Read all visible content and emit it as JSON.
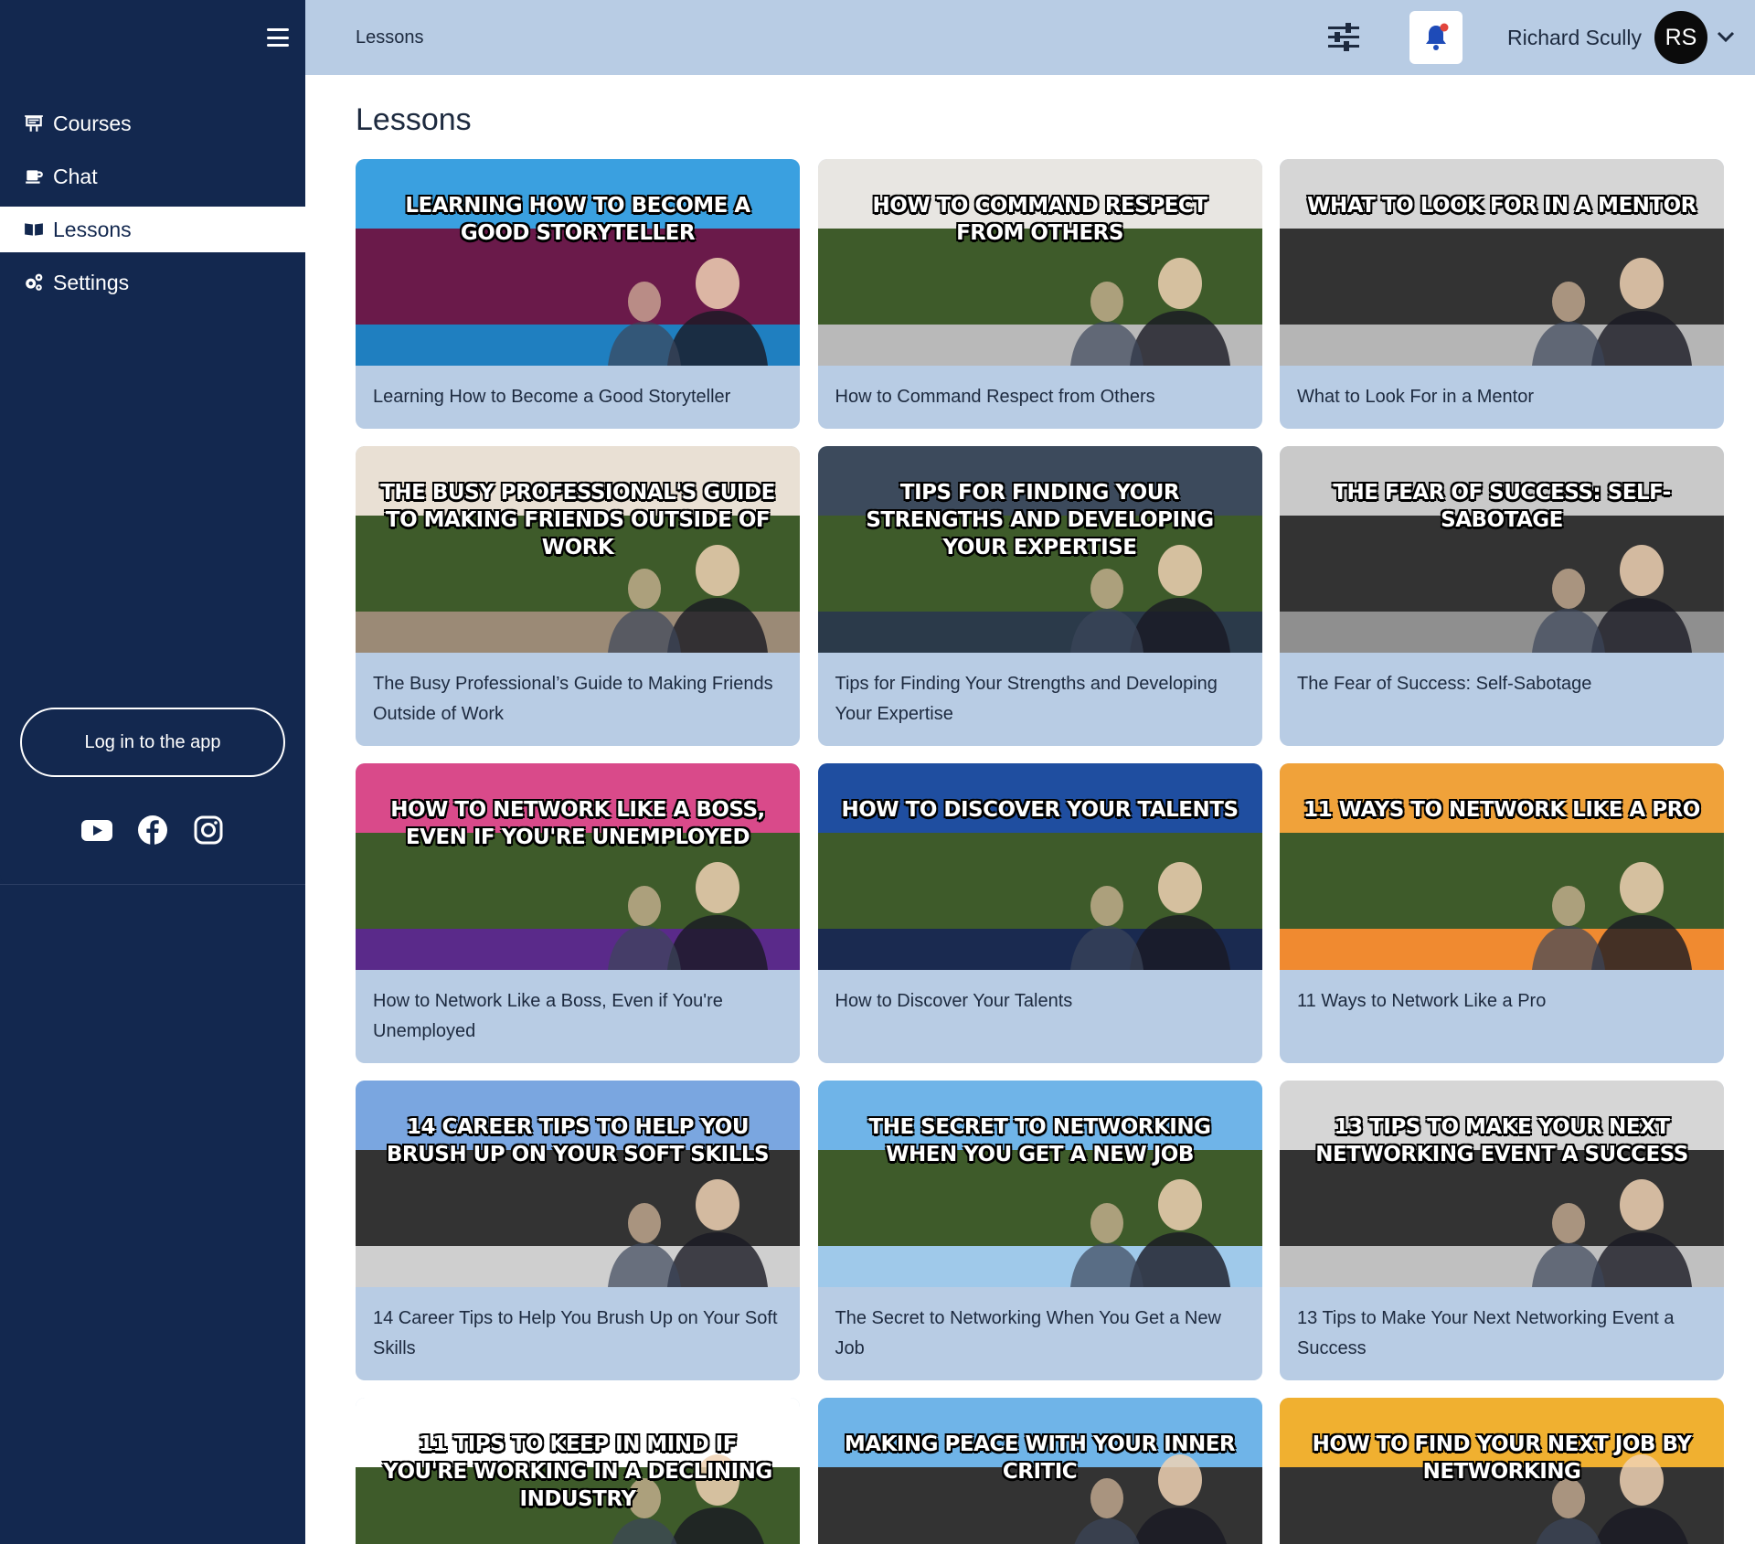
{
  "sidebar": {
    "nav": [
      {
        "label": "Courses",
        "icon": "presentation-icon"
      },
      {
        "label": "Chat",
        "icon": "coffee-icon"
      },
      {
        "label": "Lessons",
        "icon": "book-icon",
        "active": true
      },
      {
        "label": "Settings",
        "icon": "gears-icon"
      }
    ],
    "login_label": "Log in to the app",
    "social": [
      "youtube-icon",
      "facebook-icon",
      "instagram-icon"
    ]
  },
  "header": {
    "breadcrumb": "Lessons",
    "user_name": "Richard Scully",
    "avatar_initials": "RS"
  },
  "main": {
    "title": "Lessons",
    "lessons": [
      {
        "thumb_title": "Learning how to become a good storyteller",
        "label": "Learning How to Become a Good Storyteller",
        "colors": [
          "#3aa0e0",
          "#6a1a4a",
          "#1f7fc0"
        ]
      },
      {
        "thumb_title": "How to command respect from others",
        "label": "How to Command Respect from Others",
        "colors": [
          "#e8e6e2",
          "#3e5b2a",
          "#b9b9b9"
        ]
      },
      {
        "thumb_title": "What to look for in a mentor",
        "label": "What to Look For in a Mentor",
        "colors": [
          "#d6d6d6",
          "#333333",
          "#b5b5b5"
        ]
      },
      {
        "thumb_title": "The busy professional's guide to making friends outside of work",
        "label": "The Busy Professional’s Guide to Making Friends Outside of Work",
        "colors": [
          "#e9e0d4",
          "#3e5b2a",
          "#9b8a76"
        ]
      },
      {
        "thumb_title": "Tips for finding your strengths and developing your expertise",
        "label": "Tips for Finding Your Strengths and Developing Your Expertise",
        "colors": [
          "#3c4a5c",
          "#3e5b2a",
          "#2b3a4a"
        ]
      },
      {
        "thumb_title": "The fear of success: self-sabotage",
        "label": "The Fear of Success: Self-Sabotage",
        "colors": [
          "#c9c9c9",
          "#333333",
          "#8f8f8f"
        ]
      },
      {
        "thumb_title": "How to network like a boss, even if you're unemployed",
        "label": "How to Network Like a Boss, Even if You're Unemployed",
        "colors": [
          "#d94a8a",
          "#3e5b2a",
          "#5a2a8a"
        ]
      },
      {
        "thumb_title": "How to discover your talents",
        "label": "How to Discover Your Talents",
        "colors": [
          "#1f4ea0",
          "#3e5b2a",
          "#1a2a50"
        ]
      },
      {
        "thumb_title": "11 ways to network like a pro",
        "label": "11 Ways to Network Like a Pro",
        "colors": [
          "#f0a23a",
          "#3e5b2a",
          "#f08a30"
        ]
      },
      {
        "thumb_title": "14 Career Tips to Help You Brush Up on Your Soft Skills",
        "label": "14 Career Tips to Help You Brush Up on Your Soft Skills",
        "colors": [
          "#7aa6e0",
          "#333333",
          "#cfcfcf"
        ]
      },
      {
        "thumb_title": "The secret to networking when you get a new job",
        "label": "The Secret to Networking When You Get a New Job",
        "colors": [
          "#6fb4e8",
          "#3e5b2a",
          "#9fc9ea"
        ]
      },
      {
        "thumb_title": "13 tips to make your next networking event a success",
        "label": "13 Tips to Make Your Next Networking Event a Success",
        "colors": [
          "#d6d6d6",
          "#333333",
          "#c0c0c0"
        ]
      },
      {
        "thumb_title": "11 tips to keep in mind if you're working in a declining industry",
        "label": "",
        "colors": [
          "#ffffff",
          "#3e5b2a",
          "#3e5b2a"
        ]
      },
      {
        "thumb_title": "Making peace with your inner critic",
        "label": "",
        "colors": [
          "#6fb4e8",
          "#333333",
          "#333333"
        ]
      },
      {
        "thumb_title": "How to find your next job by networking",
        "label": "",
        "colors": [
          "#f0b030",
          "#333333",
          "#333333"
        ]
      }
    ]
  }
}
